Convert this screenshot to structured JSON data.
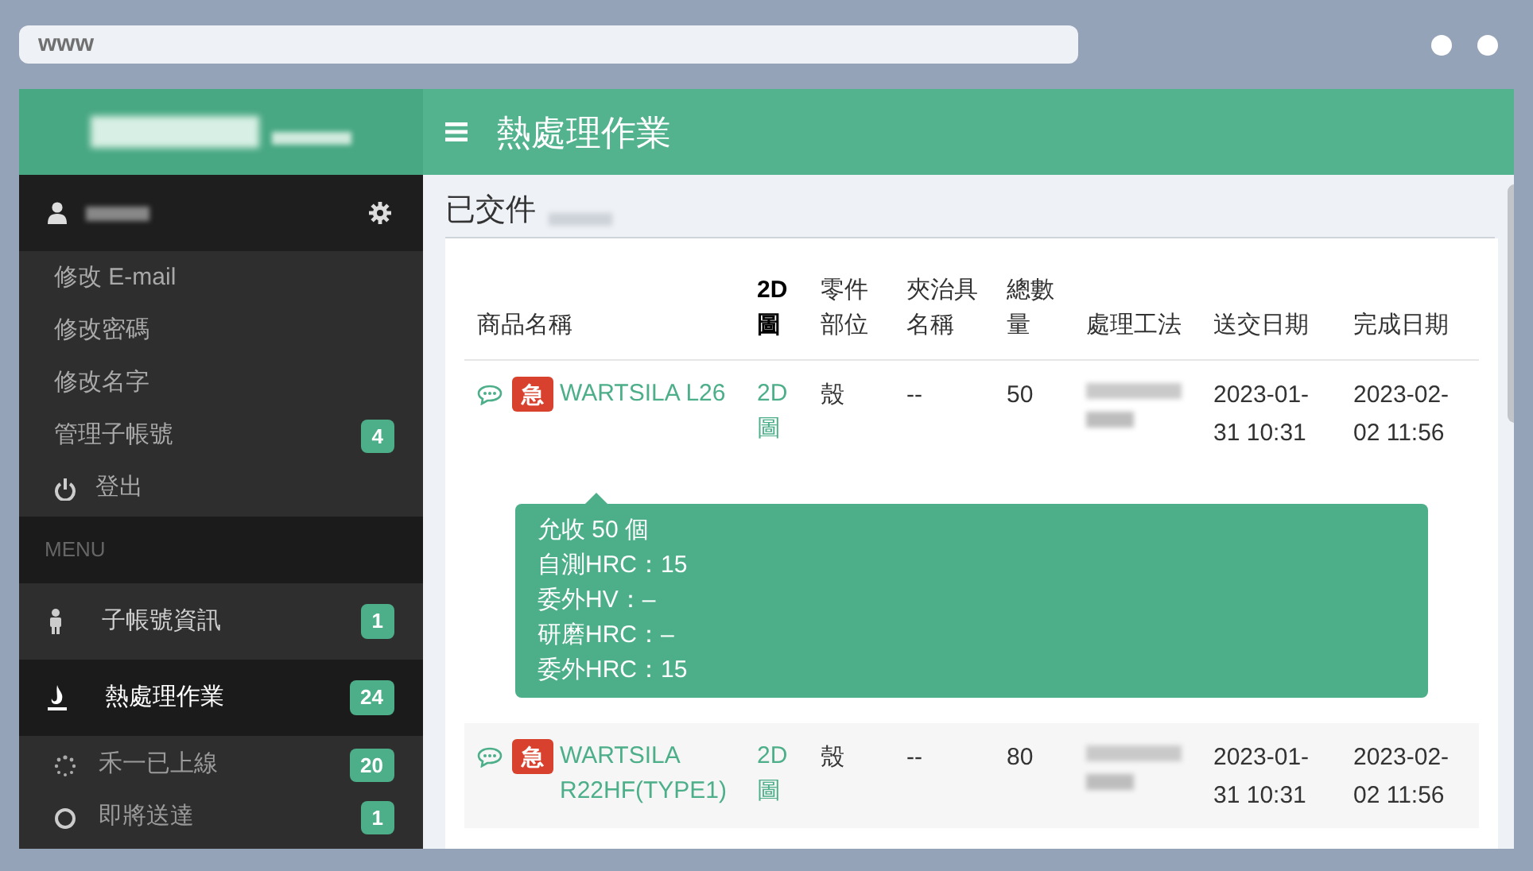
{
  "browser": {
    "address": "www"
  },
  "header": {
    "title": "熱處理作業"
  },
  "sidebar": {
    "account_menu": [
      {
        "kind": "link",
        "label": "修改 E-mail"
      },
      {
        "kind": "link",
        "label": "修改密碼"
      },
      {
        "kind": "link",
        "label": "修改名字"
      },
      {
        "kind": "link",
        "label": "管理子帳號",
        "badge": "4"
      },
      {
        "kind": "logout",
        "label": "登出"
      }
    ],
    "menu_heading": "MENU",
    "items": [
      {
        "kind": "person",
        "label": "子帳號資訊",
        "badge": "1",
        "selected": false
      },
      {
        "kind": "flame",
        "label": "熱處理作業",
        "badge": "24",
        "selected": true,
        "children": [
          {
            "kind": "spinner",
            "label": "禾一已上線",
            "badge": "20"
          },
          {
            "kind": "circle",
            "label": "即將送達",
            "badge": "1"
          }
        ]
      }
    ]
  },
  "content": {
    "title": "已交件",
    "table": {
      "columns": [
        "商品名稱",
        "2D圖",
        "零件部位",
        "夾治具名稱",
        "總數量",
        "處理工法",
        "送交日期",
        "完成日期"
      ],
      "rows": [
        {
          "urgent": "急",
          "name": "WARTSILA L26",
          "drawing": "2D圖",
          "part": "殼",
          "jig": "--",
          "quantity": "50",
          "sent": "2023-01-31 10:31",
          "done": "2023-02-02 11:56",
          "tooltip": [
            "允收 50 個",
            "自測HRC：15",
            "委外HV：–",
            "研磨HRC：–",
            "委外HRC：15"
          ]
        },
        {
          "urgent": "急",
          "name": "WARTSILA R22HF(TYPE1)",
          "drawing": "2D圖",
          "part": "殼",
          "jig": "--",
          "quantity": "80",
          "sent": "2023-01-31 10:31",
          "done": "2023-02-02 11:56"
        }
      ]
    }
  }
}
